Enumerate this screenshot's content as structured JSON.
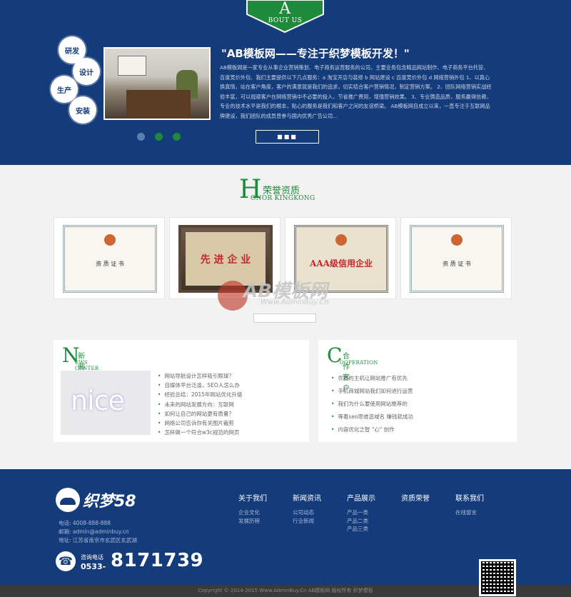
{
  "about": {
    "badge_letter": "A",
    "badge_text": "BOUT US",
    "circles": [
      "研发",
      "设计",
      "生产",
      "安装"
    ],
    "title": "\"AB模板网——专注于织梦模板开发！\"",
    "body": "AB模板网是一家专业从事企业营销策划、电子商务运营服务的公司，主要业务包含精品网站制作、电子商务平台托管、百度竞价外包、我们主要提供以下几点服务：a 淘宝开店与装修 b 网站建设 c 百度竞价外包 d 网络营销外包 1、以真心换真情，站在客户角度，客户的满意就是我们的追求，切实结合客户营销情况，制定营销方案。 2、团队网络营销实战经验丰富，可以规避客户在网络营销中不必要的投入，节省推广费用，增强营销效果。 3、专业铸造品质，服务赢得信赖，专业的技术水平是我们的根本，贴心的服务是我们和客户之间的友谊桥梁。 AB模板网自成立以来，一直专注于互联网品牌建设，我们团队的成员曾参与国内优秀广告公司...",
    "more": "■■■",
    "colors": {
      "bg": "#143c7b",
      "accent": "#1f8a3b"
    }
  },
  "honor": {
    "letter": "H",
    "title_cn": "荣誉资质",
    "title_en": "ONOR KINGKONG",
    "certs": [
      {
        "text": "资 质 证 书",
        "style": "light"
      },
      {
        "text": "先 进 企 业",
        "style": "dark"
      },
      {
        "text": "AAA级信用企业",
        "style": "light-red"
      },
      {
        "text": "资 质 证 书",
        "style": "light"
      }
    ]
  },
  "watermark": {
    "brand": "AB模板网",
    "url": "Www.AdminBuy.Cn"
  },
  "news": {
    "letter": "N",
    "title_cn": "新闻资讯",
    "title_en": "EWS CENTER",
    "image_text": "nice",
    "items": [
      "网站导航设计怎样吸引眼球？",
      "自媒体平台泛滥，SEO人怎么办",
      "经验总结：2015年网站优化升级",
      "未来的网站发展方向：互联网",
      "如何让自己的网站更有质量？",
      "网络公司告诉你有关图片裁剪",
      "怎样做一个符合w3c规范的网页"
    ]
  },
  "cooperation": {
    "letter": "C",
    "title_cn": "合作客户",
    "title_en": "OOPERATION",
    "items": [
      "优质的主机让网站推广有优先",
      "手机商城网站我们如何进行运营",
      "我们为什么要使用网站推荐的",
      "等着seo思维选域名 赚钱就成功",
      "内容优化之智 \"心\" 创作"
    ]
  },
  "footer": {
    "logo_text": "织梦58",
    "phone_line": "电话: 4008-888-888",
    "email_line": "邮箱: admin@adminbuy.cn",
    "address_line": "地址: 江苏省南京市玄武区玄武湖",
    "tel_label": "咨询电话",
    "tel_prefix": "0533-",
    "tel_number": "8171739",
    "columns": [
      {
        "title": "关于我们",
        "links": [
          "企业文化",
          "发展历程"
        ]
      },
      {
        "title": "新闻资讯",
        "links": [
          "公司动态",
          "行业新闻"
        ]
      },
      {
        "title": "产品展示",
        "links": [
          "产品一类",
          "产品二类",
          "产品三类"
        ]
      },
      {
        "title": "资质荣誉",
        "links": []
      },
      {
        "title": "联系我们",
        "links": [
          "在线留言"
        ]
      }
    ],
    "copyright": "Copyright © 2014-2015 Www.AdminBuy.Cn AB模板网 版权所有   织梦模板"
  }
}
